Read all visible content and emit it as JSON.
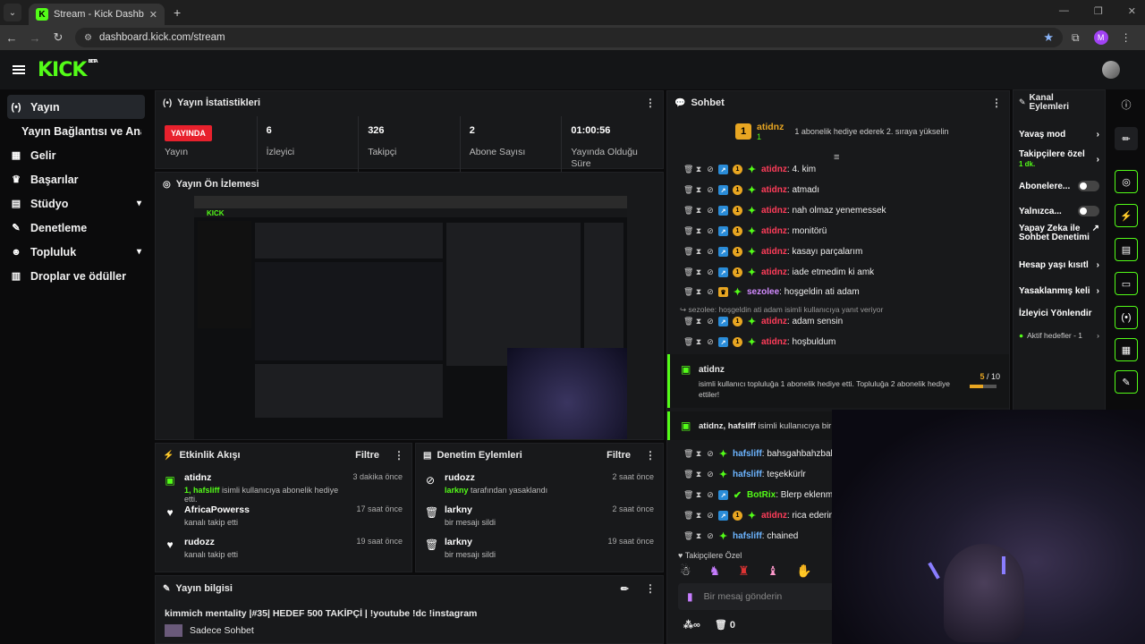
{
  "browser": {
    "tab_title": "Stream - Kick Dashboard",
    "url": "dashboard.kick.com/stream",
    "profile_initial": "M"
  },
  "header": {
    "logo": "KICK",
    "beta": "BETA"
  },
  "sidebar": {
    "items": [
      {
        "label": "Yayın",
        "icon": "broadcast-icon",
        "glyph": "(•)"
      },
      {
        "label": "Yayın Bağlantısı ve Anahtarı",
        "icon": "",
        "glyph": ""
      },
      {
        "label": "Gelir",
        "icon": "revenue-icon",
        "glyph": "▦"
      },
      {
        "label": "Başarılar",
        "icon": "trophy-icon",
        "glyph": "🏆"
      },
      {
        "label": "Stüdyo",
        "icon": "studio-icon",
        "glyph": "▤"
      },
      {
        "label": "Denetleme",
        "icon": "wrench-icon",
        "glyph": "✎"
      },
      {
        "label": "Topluluk",
        "icon": "community-icon",
        "glyph": "👥"
      },
      {
        "label": "Droplar ve ödüller",
        "icon": "gift-icon",
        "glyph": "▥"
      }
    ]
  },
  "stats_panel": {
    "title": "Yayın İstatistikleri",
    "live_badge": "YAYINDA",
    "live_label": "Yayın",
    "stats": [
      {
        "value": "6",
        "label": "İzleyici"
      },
      {
        "value": "326",
        "label": "Takipçi"
      },
      {
        "value": "2",
        "label": "Abone Sayısı"
      },
      {
        "value": "01:00:56",
        "label": "Yayında Olduğu Süre"
      }
    ]
  },
  "preview_panel": {
    "title": "Yayın Ön İzlemesi"
  },
  "activity_panel": {
    "title": "Etkinlik Akışı",
    "filter": "Filtre",
    "items": [
      {
        "name": "atidnz",
        "sub_highlight": "1, hafsliff",
        "sub": " isimli kullanıcıya abonelik hediye etti.",
        "time": "3 dakika önce"
      },
      {
        "name": "AfricaPowerss",
        "sub_highlight": "",
        "sub": "kanalı takip etti",
        "time": "17 saat önce"
      },
      {
        "name": "rudozz",
        "sub_highlight": "",
        "sub": "kanalı takip etti",
        "time": "19 saat önce"
      }
    ]
  },
  "moderation_panel": {
    "title": "Denetim Eylemleri",
    "filter": "Filtre",
    "items": [
      {
        "name": "rudozz",
        "sub_highlight": "larkny",
        "sub": " tarafından yasaklandı",
        "time": "2 saat önce"
      },
      {
        "name": "larkny",
        "sub_highlight": "",
        "sub": "bir mesajı sildi",
        "time": "2 saat önce"
      },
      {
        "name": "larkny",
        "sub_highlight": "",
        "sub": "bir mesajı sildi",
        "time": "19 saat önce"
      }
    ]
  },
  "info_panel": {
    "title": "Yayın bilgisi",
    "stream_title": "kimmich mentality |#35| HEDEF 500 TAKİPÇİ | !youtube !dc !instagram",
    "category": "Sadece Sohbet"
  },
  "chat": {
    "title": "Sohbet",
    "pinned_user": "atidnz",
    "pinned_rank": "1",
    "pinned_badge": "1",
    "pinned_text": "1 abonelik hediye ederek 2. sıraya yükselin",
    "messages": [
      {
        "user": "atidnz",
        "text": ": 4. kim",
        "color": "red"
      },
      {
        "user": "atidnz",
        "text": ": atmadı",
        "color": "red"
      },
      {
        "user": "atidnz",
        "text": ": nah olmaz yenemessek",
        "color": "red"
      },
      {
        "user": "atidnz",
        "text": ": monitörü",
        "color": "red"
      },
      {
        "user": "atidnz",
        "text": ": kasayı parçalarım",
        "color": "red"
      },
      {
        "user": "atidnz",
        "text": ": iade etmedim ki amk",
        "color": "red"
      },
      {
        "user": "sezolee",
        "text": ": hoşgeldin ati adam",
        "color": "pur"
      },
      {
        "user": "atidnz",
        "text": ": adam sensin",
        "color": "red"
      },
      {
        "user": "atidnz",
        "text": ": hoşbuldum",
        "color": "red"
      },
      {
        "user": "hafsliff",
        "text": ": bahsgahbahzbaha",
        "color": "blu"
      },
      {
        "user": "hafsliff",
        "text": ": teşekkürlr",
        "color": "blu"
      },
      {
        "user": "BotRix",
        "text": ": Blerp eklenmiş",
        "color": "grn"
      },
      {
        "user": "atidnz",
        "text": ": rica ederim",
        "color": "red"
      },
      {
        "user": "hafsliff",
        "text": ": chained",
        "color": "blu"
      }
    ],
    "reply_hint": "sezolee: hoşgeldin ati adam isimli kullanıcıya yanıt veriyor",
    "gift1": {
      "user": "atidnz",
      "text": "isimli kullanıcı topluluğa 1 abonelik hediye etti. Topluluğa 2 abonelik hediye ettiler!",
      "progress": "5",
      "total": "/ 10"
    },
    "gift2": {
      "users": "atidnz, hafsliff",
      "text": " isimli kullanıcıya bir abo"
    },
    "followers_only": "Takipçilere Özel",
    "input_placeholder": "Bir mesaj gönderin",
    "counter": "0"
  },
  "channel_actions": {
    "title": "Kanal Eylemleri",
    "rows": [
      {
        "label": "Yavaş mod",
        "kind": "chev"
      },
      {
        "label": "Takipçilere özel",
        "sub": "1 dk.",
        "kind": "chev"
      },
      {
        "label": "Abonelere...",
        "kind": "toggle"
      },
      {
        "label": "Yalnızca...",
        "kind": "toggle"
      },
      {
        "label": "Yapay Zeka ile Sohbet Denetimi",
        "kind": "ext"
      },
      {
        "label": "Hesap yaşı kısıtl",
        "kind": "chev"
      },
      {
        "label": "Yasaklanmış keli",
        "kind": "chev"
      },
      {
        "label": "İzleyici Yönlendir",
        "kind": "none"
      },
      {
        "label": "Aktif hedefler - 1",
        "kind": "chev"
      }
    ]
  },
  "colors": {
    "accent": "#53fc18",
    "live": "#e8212d",
    "panel": "#18191b",
    "bg": "#0b0b0c"
  }
}
